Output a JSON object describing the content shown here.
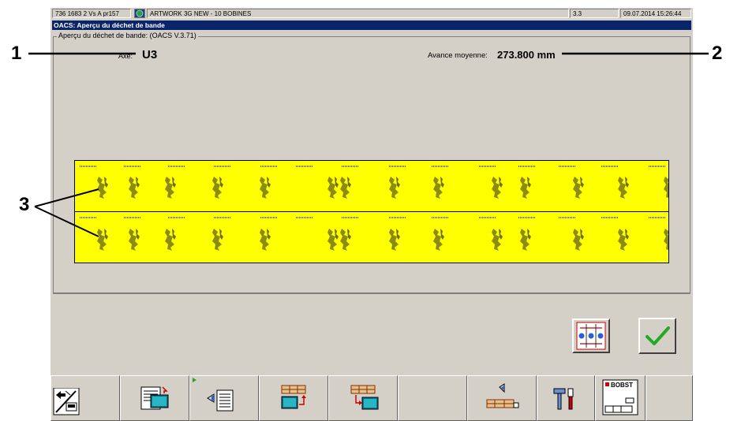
{
  "status_bar": {
    "job_id": "736 1683 2 Vs A pr157",
    "job_name": "ARTWORK 3G NEW - 10 BOBINES",
    "version": "3.3",
    "datetime": "09.07.2014 15:26:44"
  },
  "window": {
    "title": "OACS: Aperçu du déchet de bande",
    "group_label": "Aperçu du déchet de bande: (OACS V.3.71)"
  },
  "info": {
    "axis_label": "Axe:",
    "axis_value": "U3",
    "advance_label": "Avance moyenne:",
    "advance_value": "273.800 mm"
  },
  "callouts": {
    "c1": "1",
    "c2": "2",
    "c3": "3"
  },
  "colors": {
    "strip": "#ffff00",
    "title": "#0a246a",
    "check": "#22aa22",
    "logo_red": "#d40000"
  },
  "bottom_toolbar": [
    {
      "name": "exit-icon"
    },
    {
      "name": "monitor-list-icon"
    },
    {
      "name": "list-back-icon"
    },
    {
      "name": "monitor-upload-icon"
    },
    {
      "name": "monitor-download-icon"
    },
    {
      "name": "empty"
    },
    {
      "name": "roll-eye-icon"
    },
    {
      "name": "tools-icon"
    },
    {
      "name": "bobst-logo",
      "label": "BOBST"
    },
    {
      "name": "empty"
    }
  ]
}
